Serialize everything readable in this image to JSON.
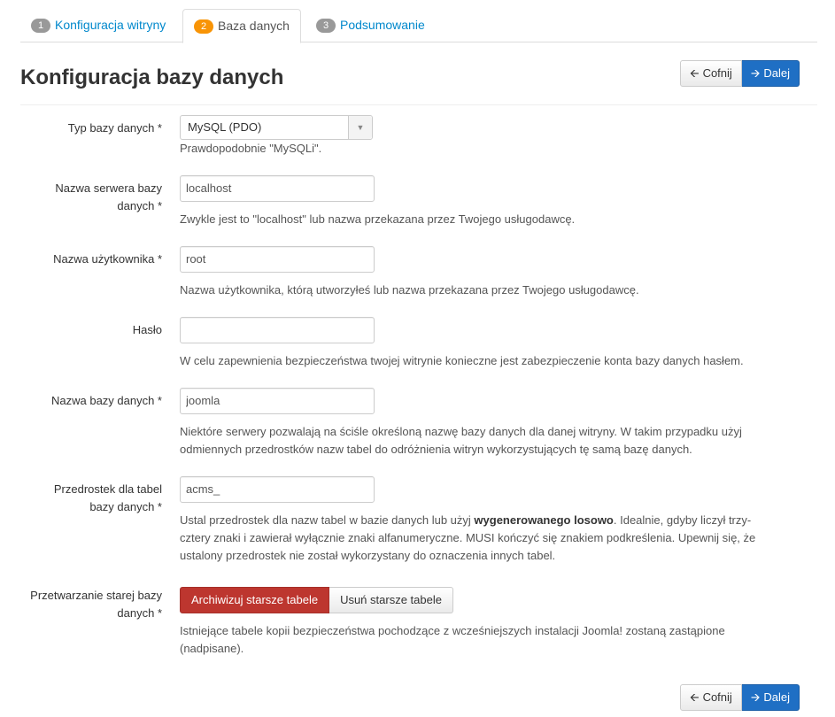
{
  "tabs": [
    {
      "num": "1",
      "label": "Konfiguracja witryny"
    },
    {
      "num": "2",
      "label": "Baza danych"
    },
    {
      "num": "3",
      "label": "Podsumowanie"
    }
  ],
  "page_title": "Konfiguracja bazy danych",
  "nav": {
    "back_label": "Cofnij",
    "next_label": "Dalej",
    "back_icon": "arrow-left-icon",
    "next_icon": "arrow-right-icon"
  },
  "form": {
    "db_type": {
      "label": "Typ bazy danych *",
      "value": "MySQL (PDO)",
      "help": "Prawdopodobnie \"MySQLi\"."
    },
    "host": {
      "label_line1": "Nazwa serwera bazy",
      "label_line2": "danych *",
      "value": "localhost",
      "help": "Zwykle jest to \"localhost\" lub nazwa przekazana przez Twojego usługodawcę."
    },
    "user": {
      "label": "Nazwa użytkownika *",
      "value": "root",
      "help": "Nazwa użytkownika, którą utworzyłeś lub nazwa przekazana przez Twojego usługodawcę."
    },
    "password": {
      "label": "Hasło",
      "value": "",
      "help": "W celu zapewnienia bezpieczeństwa twojej witrynie konieczne jest zabezpieczenie konta bazy danych hasłem."
    },
    "db_name": {
      "label": "Nazwa bazy danych *",
      "value": "joomla",
      "help_line1": "Niektóre serwery pozwalają na ściśle określoną nazwę bazy danych dla danej witryny. W takim przypadku użyj",
      "help_line2": "odmiennych przedrostków nazw tabel do odróżnienia witryn wykorzystujących tę samą bazę danych."
    },
    "prefix": {
      "label_line1": "Przedrostek dla tabel",
      "label_line2": "bazy danych *",
      "value": "acms_",
      "help_pre": "Ustal przedrostek dla nazw tabel w bazie danych lub użyj ",
      "help_bold": "wygenerowanego losowo",
      "help_post": ". Idealnie, gdyby liczył trzy-",
      "help_line2": "cztery znaki i zawierał wyłącznie znaki alfanumeryczne. MUSI kończyć się znakiem podkreślenia. Upewnij się, że",
      "help_line3": "ustalony przedrostek nie został wykorzystany do oznaczenia innych tabel."
    },
    "old_db": {
      "label_line1": "Przetwarzanie starej bazy",
      "label_line2": "danych *",
      "option_backup": "Archiwizuj starsze tabele",
      "option_remove": "Usuń starsze tabele",
      "help_line1": "Istniejące tabele kopii bezpieczeństwa pochodzące z wcześniejszych instalacji Joomla! zostaną zastąpione",
      "help_line2": "(nadpisane)."
    }
  },
  "colors": {
    "accent_tab_badge": "#f89406",
    "primary_button": "#1f6fc4",
    "danger_button": "#bd362f",
    "link": "#0088cc"
  }
}
